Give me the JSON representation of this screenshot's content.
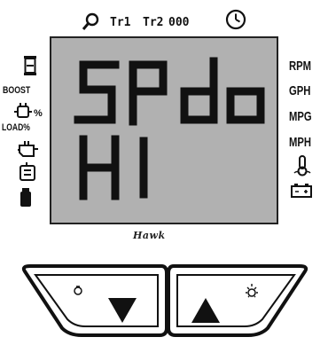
{
  "top_bar": {
    "trip1_label": "Tr1",
    "trip2_label": "Tr2",
    "trip2_value": "000",
    "search_icon": "magnifier-icon",
    "clock_icon": "clock-icon"
  },
  "left_panel": {
    "timer_icon": "hourglass-icon",
    "boost_label": "BOOST",
    "load_percent_label": "%",
    "load_label": "LOAD%"
  },
  "right_panel": {
    "units": [
      "RPM",
      "GPH",
      "MPG",
      "MPH"
    ],
    "temp_icon": "thermometer-icon",
    "battery_icon": "battery-icon"
  },
  "display": {
    "line1": "SPdo",
    "line2": "HI"
  },
  "brand": {
    "name": "Hawk"
  },
  "buttons": {
    "down_label": "▼",
    "up_label": "▲",
    "light_icon": "light-icon",
    "dim_icon": "dim-icon"
  }
}
